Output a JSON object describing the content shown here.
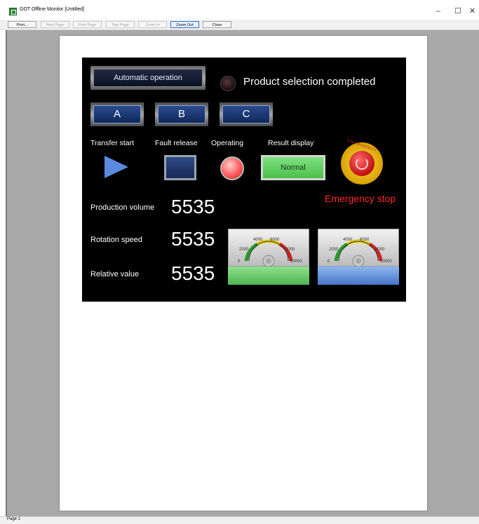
{
  "window": {
    "title": "GOT Offline Monitor [Untitled]",
    "controls": {
      "minimize": "–",
      "maximize": "☐",
      "close": "✕"
    },
    "icon": "app-icon"
  },
  "toolbar": {
    "print": "Print...",
    "next_page": "Next Page",
    "prev_page": "Prev Page",
    "two_page": "Two Page",
    "zoom_in": "Zoom In",
    "zoom_out": "Zoom Out",
    "close": "Close"
  },
  "status": {
    "page": "Page 1"
  },
  "hmi": {
    "auto_button": "Automatic operation",
    "product_selection": "Product selection completed",
    "select_buttons": [
      "A",
      "B",
      "C"
    ],
    "labels": {
      "transfer_start": "Transfer start",
      "fault_release": "Fault release",
      "operating": "Operating",
      "result_display": "Result display"
    },
    "result_value": "Normal",
    "emergency_ring": "EMERGENCY",
    "emergency_stop": "Emergency stop",
    "rows": [
      {
        "label": "Production volume",
        "value": "5535"
      },
      {
        "label": "Rotation speed",
        "value": "5535"
      },
      {
        "label": "Relative value",
        "value": "5535"
      }
    ],
    "gauges": [
      {
        "ticks": [
          "0",
          "2000",
          "4000",
          "6000",
          "8000",
          "10000"
        ],
        "color": "#4fb44f"
      },
      {
        "ticks": [
          "0",
          "2000",
          "4000",
          "6000",
          "8000",
          "10000"
        ],
        "color": "#4575c8"
      }
    ],
    "colors": {
      "screen_bg": "#000000",
      "emergency_text": "#ff2a2a",
      "lamp_on": "#ff5a5a"
    }
  }
}
